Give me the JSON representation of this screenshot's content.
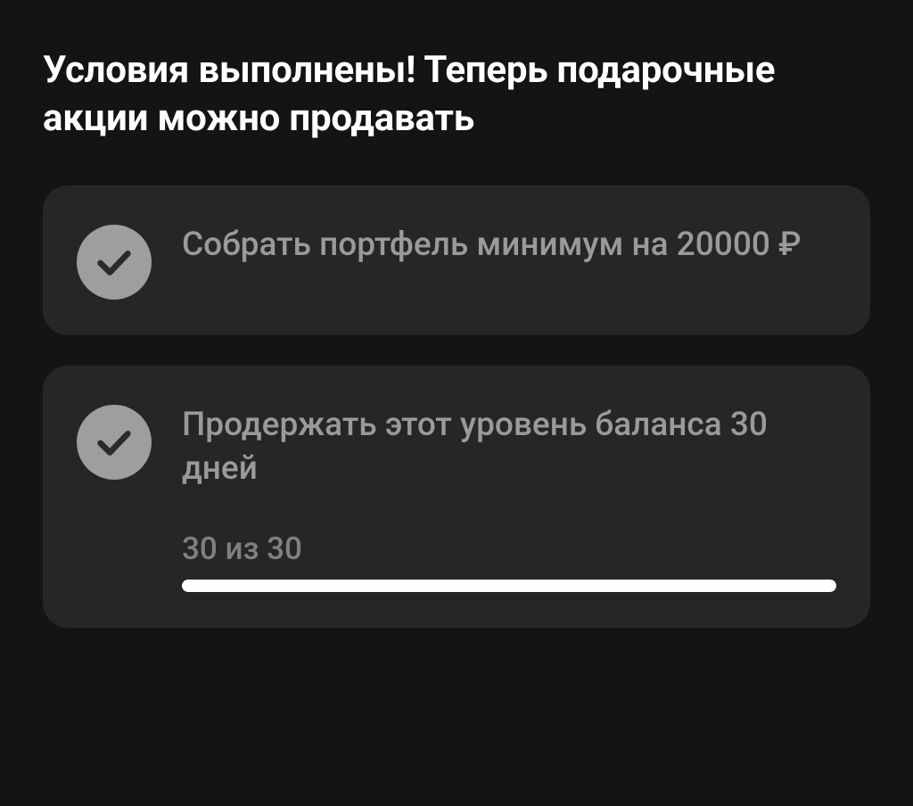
{
  "heading": "Условия выполнены! Теперь подарочные акции можно продавать",
  "conditions": {
    "portfolio": {
      "text": "Собрать портфель минимум на 20000 ₽",
      "completed": true
    },
    "balance": {
      "text": "Продержать этот уровень баланса 30 дней",
      "completed": true,
      "progress": {
        "label": "30 из 30",
        "current": 30,
        "total": 30,
        "percent": 100
      }
    }
  }
}
